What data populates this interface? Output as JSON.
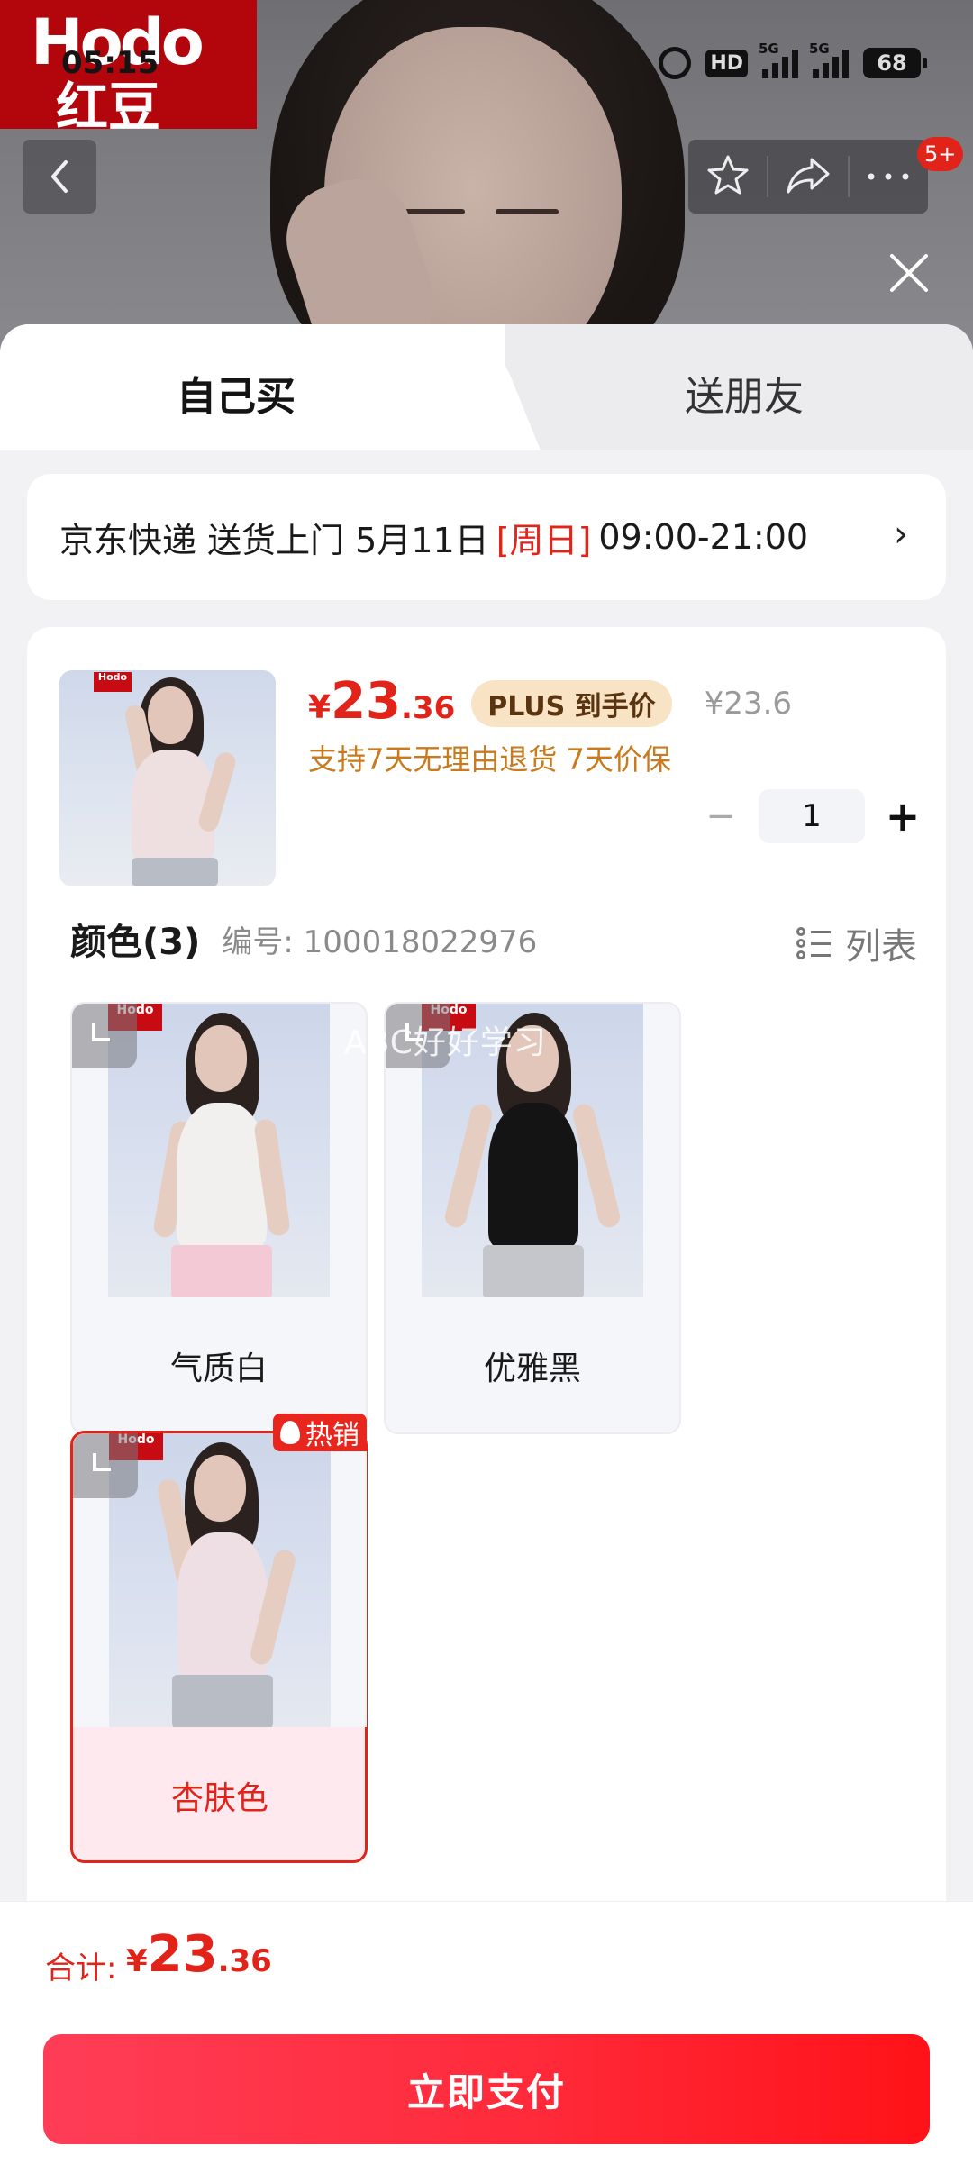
{
  "status_bar": {
    "time": "05:15",
    "hd": "HD",
    "net1": "5G",
    "net2": "5G",
    "battery": "68"
  },
  "hero": {
    "brand_top": "Hodo",
    "brand_bottom": "红豆",
    "cart_badge": "5+"
  },
  "tabs": {
    "self": "自己买",
    "friend": "送朋友"
  },
  "delivery": {
    "text": "京东快递 送货上门 5月11日",
    "weekday": "[周日]",
    "time": "09:00-21:00",
    "chevron": "›"
  },
  "product": {
    "price_symbol": "¥",
    "price_int": "23",
    "price_dec": ".36",
    "plus_tag": "PLUS 到手价",
    "orig_price": "¥23.6",
    "guarantee": "支持7天无理由退货  7天价保",
    "quantity": "1",
    "minus": "−",
    "plus": "+"
  },
  "color_section": {
    "title": "颜色(3)",
    "sku": "编号: 100018022976",
    "list_toggle": "列表",
    "options": [
      {
        "label": "气质白",
        "selected": false
      },
      {
        "label": "优雅黑",
        "selected": false
      },
      {
        "label": "杏肤色",
        "selected": true,
        "tag": "热销"
      }
    ]
  },
  "watermark": "ABC好好学习",
  "total": {
    "label": "合计:",
    "symbol": "¥",
    "int": "23",
    "dec": ".36"
  },
  "pay_button": "立即支付",
  "colors": {
    "accent": "#e2231a",
    "pay_start": "#ff3d57",
    "pay_end": "#ff1218",
    "plus_bg": "#f9e3c5",
    "guarantee": "#c97a1c"
  }
}
